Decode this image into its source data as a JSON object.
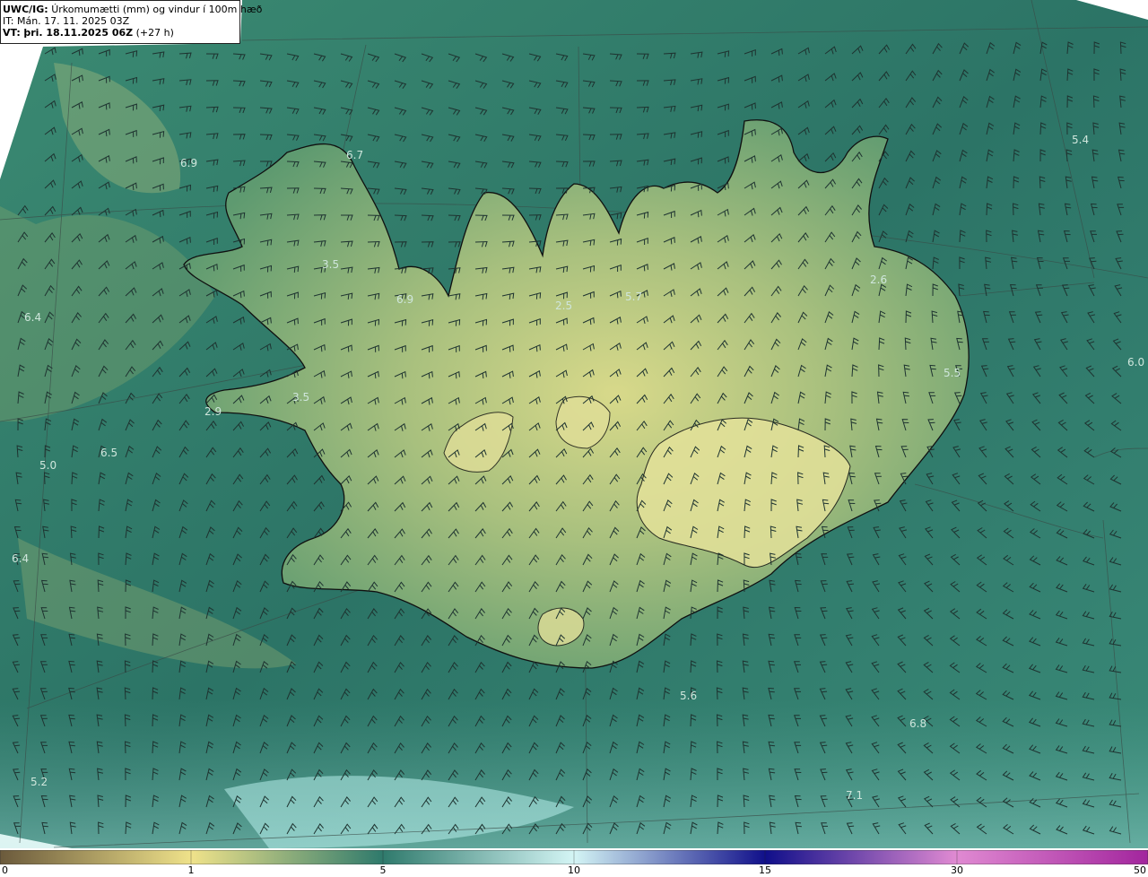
{
  "header": {
    "model_label": "UWC/IG:",
    "product_title": "Úrkomumætti (mm) og vindur í 100m hæð",
    "init_time": "IT: Mán. 17. 11. 2025 03Z",
    "valid_label": "VT:",
    "valid_time": "þri. 18.11.2025 06Z",
    "lead_time": "(+27 h)"
  },
  "colorbar": {
    "tick_labels": [
      "0",
      "1",
      "5",
      "10",
      "15",
      "30",
      "50"
    ],
    "colors": {
      "c0": "#6b5a3c",
      "c1": "#efe28a",
      "c5": "#2f7a6c",
      "c10": "#d4f5f5",
      "c15": "#100f8a",
      "c30": "#e08ad2",
      "c50": "#a2259d"
    }
  },
  "map": {
    "value_labels": [
      "6.7",
      "6.9",
      "3.5",
      "6.4",
      "6.9",
      "2.5",
      "5.7",
      "2.6",
      "5.4",
      "5.5",
      "6.0",
      "3.5",
      "2.9",
      "6.5",
      "5.0",
      "6.4",
      "5.6",
      "6.8",
      "5.2",
      "7.1"
    ],
    "colors": {
      "sea": "#2f7a68",
      "land_low": "#5a9a6a",
      "land_high": "#d6d88a",
      "coast": "#101010",
      "barb": "#1e3330",
      "value_text": "#cfe6dc"
    },
    "icons": [
      "wind-barb-icon",
      "coastline",
      "glacier-outline"
    ]
  }
}
